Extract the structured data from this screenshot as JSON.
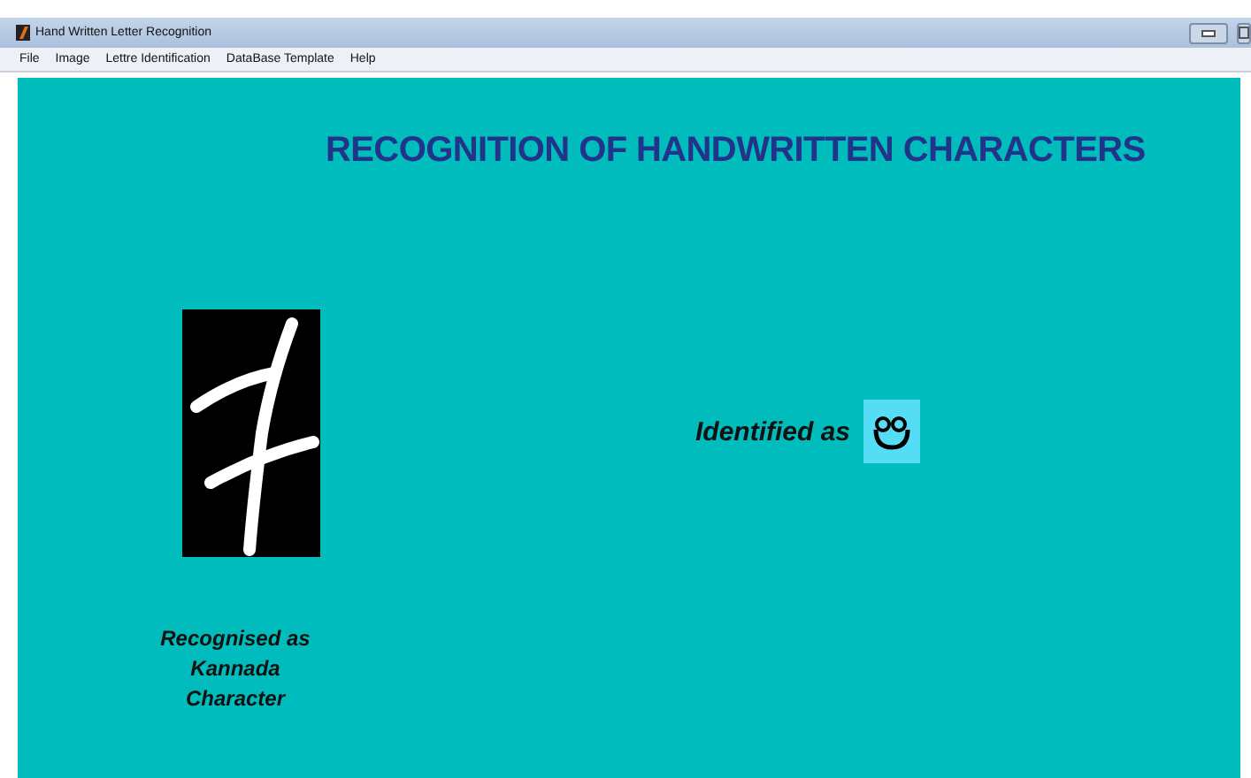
{
  "window": {
    "title": "Hand Written Letter Recognition"
  },
  "menu": [
    "File",
    "Image",
    "Lettre Identification",
    "DataBase Template",
    "Help"
  ],
  "heading": "RECOGNITION OF HANDWRITTEN CHARACTERS",
  "input": {
    "caption": "Recognised as Kannada Character"
  },
  "result": {
    "label": "Identified as"
  }
}
